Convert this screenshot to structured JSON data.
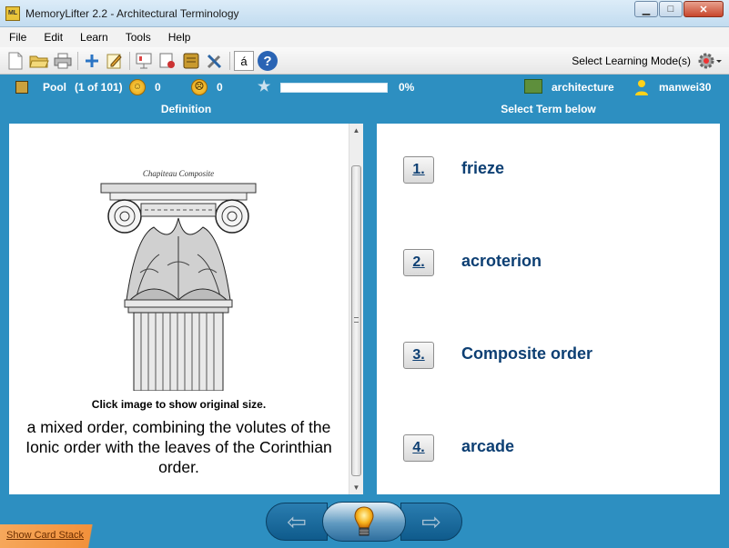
{
  "window": {
    "title": "MemoryLifter 2.2 - Architectural Terminology",
    "icon_text": "ML",
    "minimize_glyph": "▁",
    "maximize_glyph": "□",
    "close_glyph": "✕"
  },
  "menu": [
    "File",
    "Edit",
    "Learn",
    "Tools",
    "Help"
  ],
  "toolbar": {
    "icons": [
      "new-document-icon",
      "open-folder-icon",
      "print-icon",
      "add-card-icon",
      "edit-icon",
      "presentation-icon",
      "card-print-icon",
      "box-icon",
      "tools-icon",
      "character-icon",
      "help-icon"
    ],
    "character_glyph": "á",
    "help_glyph": "?",
    "select_mode_label": "Select Learning Mode(s)"
  },
  "status": {
    "pool_label": "Pool",
    "pool_count": "(1 of 101)",
    "happy_count": "0",
    "sad_count": "0",
    "progress_fraction": 0.0,
    "progress_text": "0%",
    "category": "architecture",
    "user": "manwei30"
  },
  "colors": {
    "background": "#2d8fc1",
    "term_text": "#0d3f73",
    "show_stack": "#f2913b"
  },
  "left": {
    "header": "Definition",
    "image_label": "Chapiteau Composite",
    "image_caption": "Click image to show original size.",
    "definition": "a mixed order, combining the volutes of the Ionic order with the leaves of the Corinthian order."
  },
  "right": {
    "header": "Select Term below",
    "answers": [
      {
        "num": "1.",
        "term": "frieze"
      },
      {
        "num": "2.",
        "term": "acroterion"
      },
      {
        "num": "3.",
        "term": "Composite order"
      },
      {
        "num": "4.",
        "term": "arcade"
      }
    ]
  },
  "nav": {
    "prev_glyph": "⇦",
    "next_glyph": "⇨"
  },
  "footer": {
    "show_card_stack": "Show Card Stack"
  }
}
